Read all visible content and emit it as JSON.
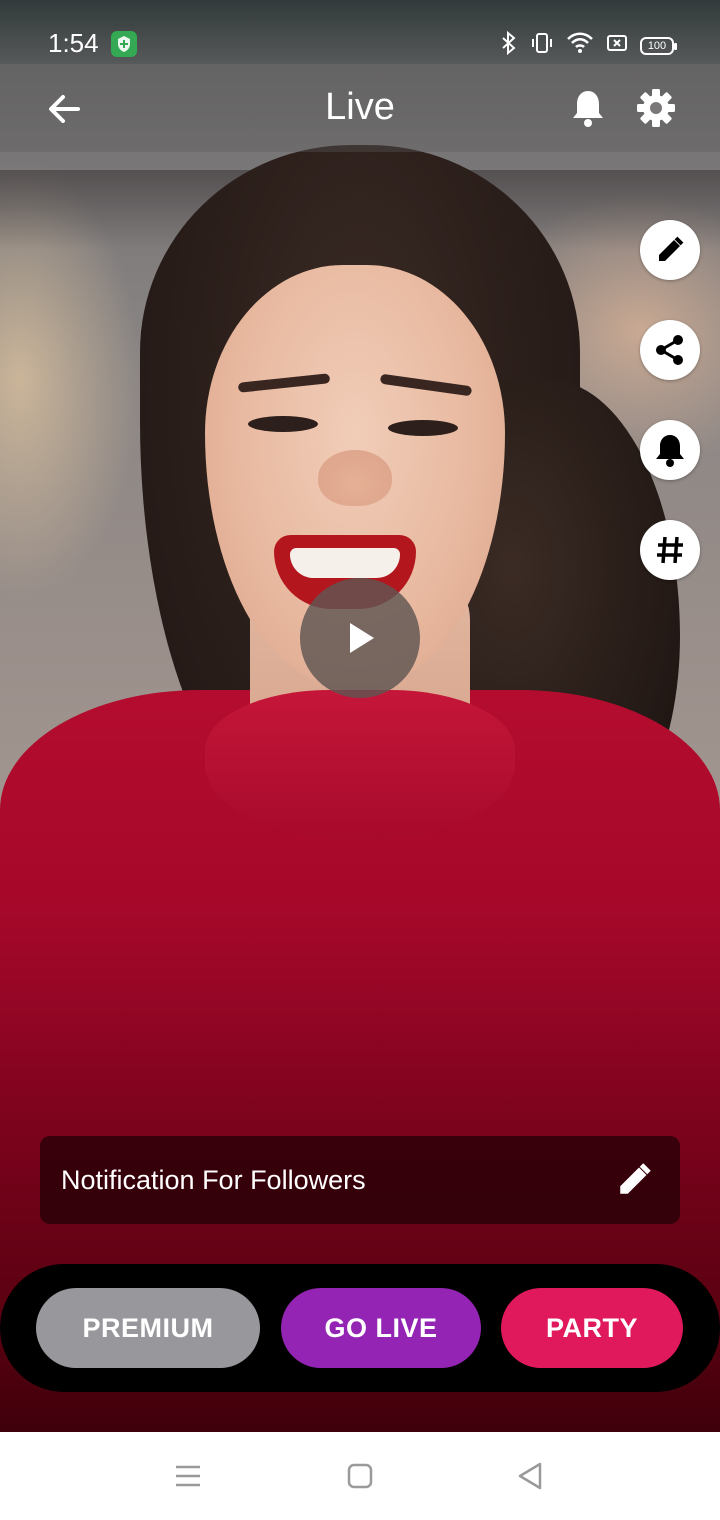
{
  "status_bar": {
    "time": "1:54",
    "battery": "100",
    "icons": [
      "shield-app-icon",
      "bluetooth-icon",
      "vibrate-icon",
      "wifi-icon",
      "sim-icon",
      "battery-icon"
    ]
  },
  "app_bar": {
    "title": "Live",
    "icons": [
      "back-arrow-icon",
      "bell-icon",
      "gear-icon"
    ]
  },
  "side_actions": [
    "edit-icon",
    "share-icon",
    "bell-icon",
    "hashtag-icon"
  ],
  "player": {
    "icon": "play-icon"
  },
  "notification": {
    "label": "Notification For Followers",
    "icon": "edit-icon"
  },
  "modes": {
    "premium": "PREMIUM",
    "go_live": "GO LIVE",
    "party": "PARTY",
    "colors": {
      "premium": "#98979b",
      "go_live": "#9424b4",
      "party": "#e0185c"
    }
  },
  "system_nav": [
    "menu-icon",
    "home-icon",
    "back-icon"
  ]
}
